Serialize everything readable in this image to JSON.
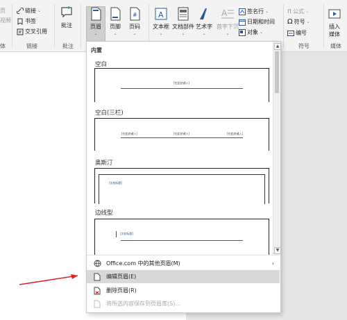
{
  "ribbon": {
    "links_group": {
      "link": "链接",
      "bookmark": "书签",
      "crossref": "交叉引用",
      "label": "链接"
    },
    "partial_left": {
      "label_top": "页",
      "label_mid": "视频",
      "group": "体"
    },
    "comments_group": {
      "comment": "批注",
      "label": "批注"
    },
    "hf_group": {
      "header": "页眉",
      "footer": "页脚",
      "pagenum": "页码"
    },
    "text_group": {
      "textbox": "文本框",
      "quickparts": "文档部件",
      "wordart": "艺术字",
      "dropcap": "首字下沉",
      "sigline": "签名行",
      "datetime": "日期和时间",
      "object": "对象"
    },
    "symbols_group": {
      "equation": "公式",
      "symbol": "符号",
      "number": "编号",
      "label": "符号"
    },
    "media_group": {
      "insert": "插入",
      "media": "媒体",
      "label": "媒体"
    }
  },
  "dropdown": {
    "section": "内置",
    "items": [
      {
        "title": "空白",
        "placeholders": [
          "[在此处键入]"
        ]
      },
      {
        "title": "空白(三栏)",
        "placeholders": [
          "[在此处键入]",
          "[在此处键入]",
          "[在此处键入]"
        ]
      },
      {
        "title": "奥斯汀",
        "placeholders": [
          "[文档标题]"
        ]
      },
      {
        "title": "边线型",
        "placeholders": [
          "[文档标题]"
        ]
      }
    ],
    "menu": {
      "office": "Office.com 中的其他页眉(M)",
      "edit": "编辑页眉(E)",
      "remove": "删除页眉(R)",
      "save": "将所选内容保存到页眉库(S)..."
    }
  },
  "colors": {
    "accent": "#2b579a",
    "arrow": "#e02020"
  }
}
